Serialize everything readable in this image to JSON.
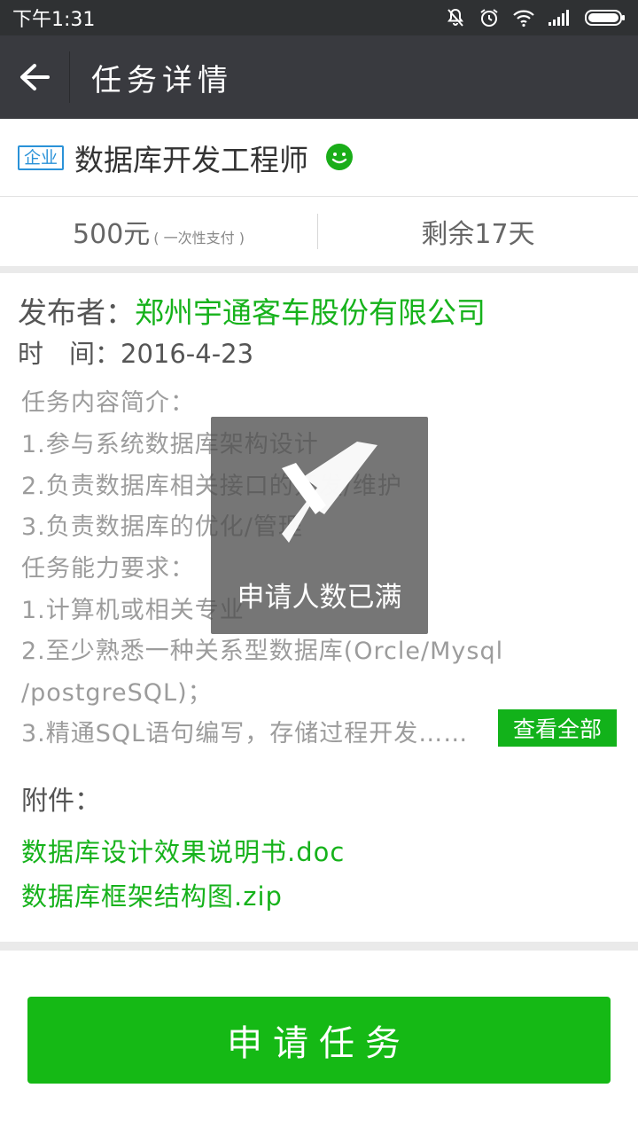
{
  "status_bar": {
    "time": "下午1:31",
    "icons": [
      "mute-icon",
      "alarm-icon",
      "wifi-icon",
      "signal-icon",
      "battery-icon"
    ]
  },
  "title_bar": {
    "back_icon": "back-arrow-icon",
    "title": "任务详情"
  },
  "task": {
    "badge": "企业",
    "title": "数据库开发工程师",
    "badge_color": "#2a92d8"
  },
  "price": {
    "amount": "500元",
    "payment_note": "( 一次性支付 )",
    "remaining": "剩余17天"
  },
  "details": {
    "publisher_label": "发布者：",
    "publisher_name": "郑州宇通客车股份有限公司",
    "time_line": "时　间：2016-4-23",
    "description": [
      "任务内容简介：",
      "1.参与系统数据库架构设计",
      "2.负责数据库相关接口的开发/维护",
      "3.负责数据库的优化/管理",
      "任务能力要求：",
      "1.计算机或相关专业",
      "2.至少熟悉一种关系型数据库(Orcle/Mysql",
      "/postgreSQL)；",
      "3.精通SQL语句编写，存储过程开发……"
    ],
    "view_all": "查看全部"
  },
  "attachments": {
    "title": "附件：",
    "files": [
      "数据库设计效果说明书.doc",
      "数据库框架结构图.zip"
    ]
  },
  "overlay": {
    "icon": "close-x-icon",
    "text": "申请人数已满"
  },
  "apply_button": "申请任务",
  "colors": {
    "accent_green": "#15b915",
    "title_bar": "#393a3f",
    "status_bar": "#2f3133"
  }
}
